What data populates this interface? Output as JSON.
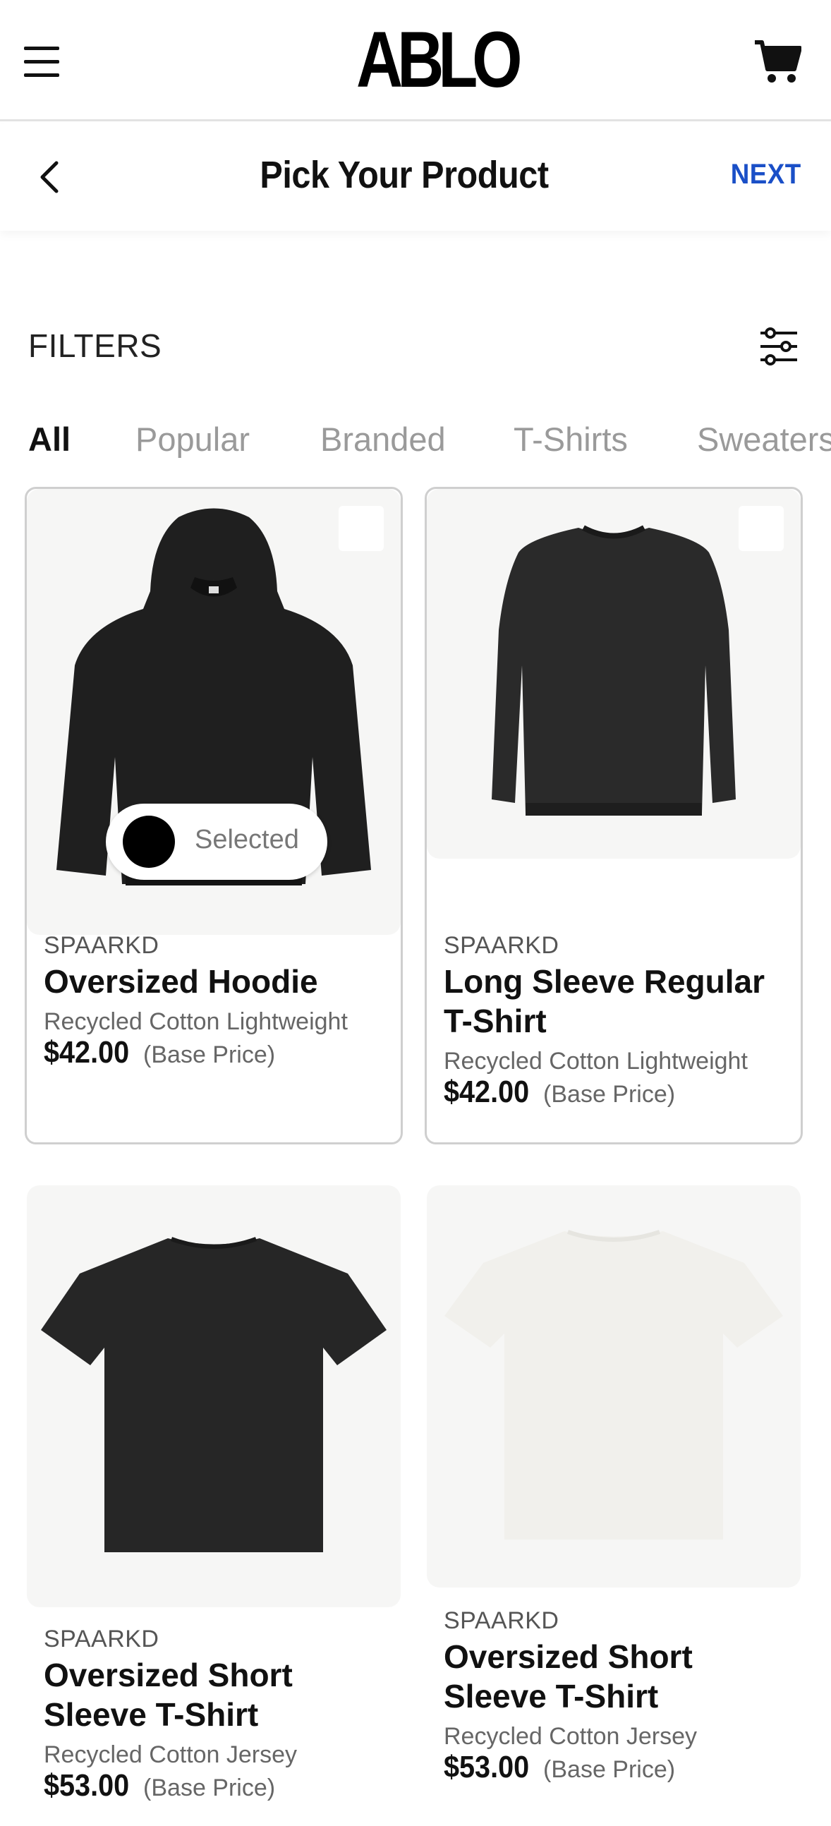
{
  "app": {
    "logo_text": "ABLO",
    "menu_icon": "hamburger-menu-icon",
    "cart_icon": "shopping-cart-icon"
  },
  "header": {
    "title": "Pick Your Product",
    "back_icon": "chevron-left-icon",
    "next_label": "NEXT",
    "next_color": "#1a4fc7"
  },
  "filters": {
    "label": "FILTERS",
    "icon": "sliders-icon",
    "tabs": [
      {
        "label": "All",
        "active": true
      },
      {
        "label": "Popular",
        "active": false
      },
      {
        "label": "Branded",
        "active": false
      },
      {
        "label": "T-Shirts",
        "active": false
      },
      {
        "label": "Sweaters",
        "active": false
      }
    ]
  },
  "products": [
    {
      "brand": "SPAARKD",
      "name": "Oversized Hoodie",
      "material": "Recycled Cotton Lightweight",
      "price": "$42.00",
      "price_note": "(Base Price)",
      "selected": true,
      "selected_label": "Selected",
      "selected_color": "#000000",
      "image": "black-hoodie"
    },
    {
      "brand": "SPAARKD",
      "name": "Long Sleeve Regular T-Shirt",
      "material": "Recycled Cotton Lightweight",
      "price": "$42.00",
      "price_note": "(Base Price)",
      "selected": false,
      "image": "black-long-sleeve"
    },
    {
      "brand": "SPAARKD",
      "name": "Oversized Short Sleeve T-Shirt",
      "material": "Recycled Cotton Jersey",
      "price": "$53.00",
      "price_note": "(Base Price)",
      "selected": false,
      "image": "black-tshirt"
    },
    {
      "brand": "SPAARKD",
      "name": "Oversized Short Sleeve T-Shirt",
      "material": "Recycled Cotton Jersey",
      "price": "$53.00",
      "price_note": "(Base Price)",
      "selected": false,
      "image": "white-tshirt"
    }
  ]
}
